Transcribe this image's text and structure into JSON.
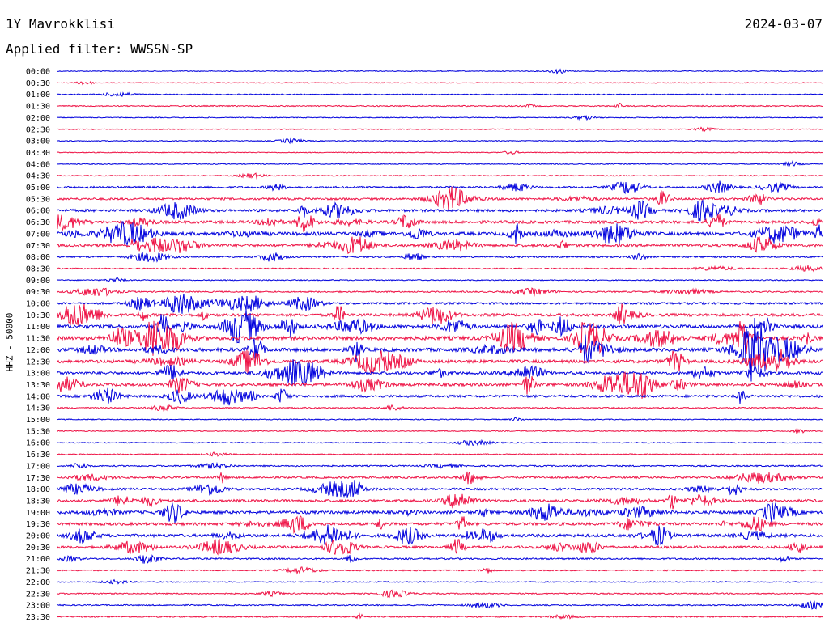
{
  "header": {
    "station": "1Y Mavrokklisi",
    "date": "2024-03-07",
    "filter": "Applied filter: WWSSN-SP"
  },
  "chart_data": {
    "type": "line",
    "title": "1Y Mavrokklisi",
    "subtitle": "Applied filter: WWSSN-SP",
    "ylabel": "HHZ - 50000",
    "xlabel": "",
    "colors": {
      "even_row": "#0000dd",
      "odd_row": "#ee1144"
    },
    "grid": false,
    "legend": "none",
    "row_labels": [
      "00:00",
      "00:30",
      "01:00",
      "01:30",
      "02:00",
      "02:30",
      "03:00",
      "03:30",
      "04:00",
      "04:30",
      "05:00",
      "05:30",
      "06:00",
      "06:30",
      "07:00",
      "07:30",
      "08:00",
      "08:30",
      "09:00",
      "09:30",
      "10:00",
      "10:30",
      "11:00",
      "11:30",
      "12:00",
      "12:30",
      "13:00",
      "13:30",
      "14:00",
      "14:30",
      "15:00",
      "15:30",
      "16:00",
      "16:30",
      "17:00",
      "17:30",
      "18:00",
      "18:30",
      "19:00",
      "19:30",
      "20:00",
      "20:30",
      "21:00",
      "21:30",
      "22:00",
      "22:30",
      "23:00",
      "23:30"
    ],
    "row_activity": [
      0.05,
      0.04,
      0.08,
      0.12,
      0.05,
      0.05,
      0.05,
      0.05,
      0.06,
      0.08,
      0.35,
      0.4,
      0.55,
      0.6,
      0.75,
      0.55,
      0.25,
      0.15,
      0.1,
      0.2,
      0.4,
      0.6,
      0.8,
      0.85,
      0.8,
      0.7,
      0.6,
      0.65,
      0.5,
      0.15,
      0.08,
      0.08,
      0.08,
      0.1,
      0.2,
      0.35,
      0.4,
      0.5,
      0.65,
      0.6,
      0.65,
      0.5,
      0.25,
      0.15,
      0.1,
      0.15,
      0.15,
      0.15
    ]
  }
}
